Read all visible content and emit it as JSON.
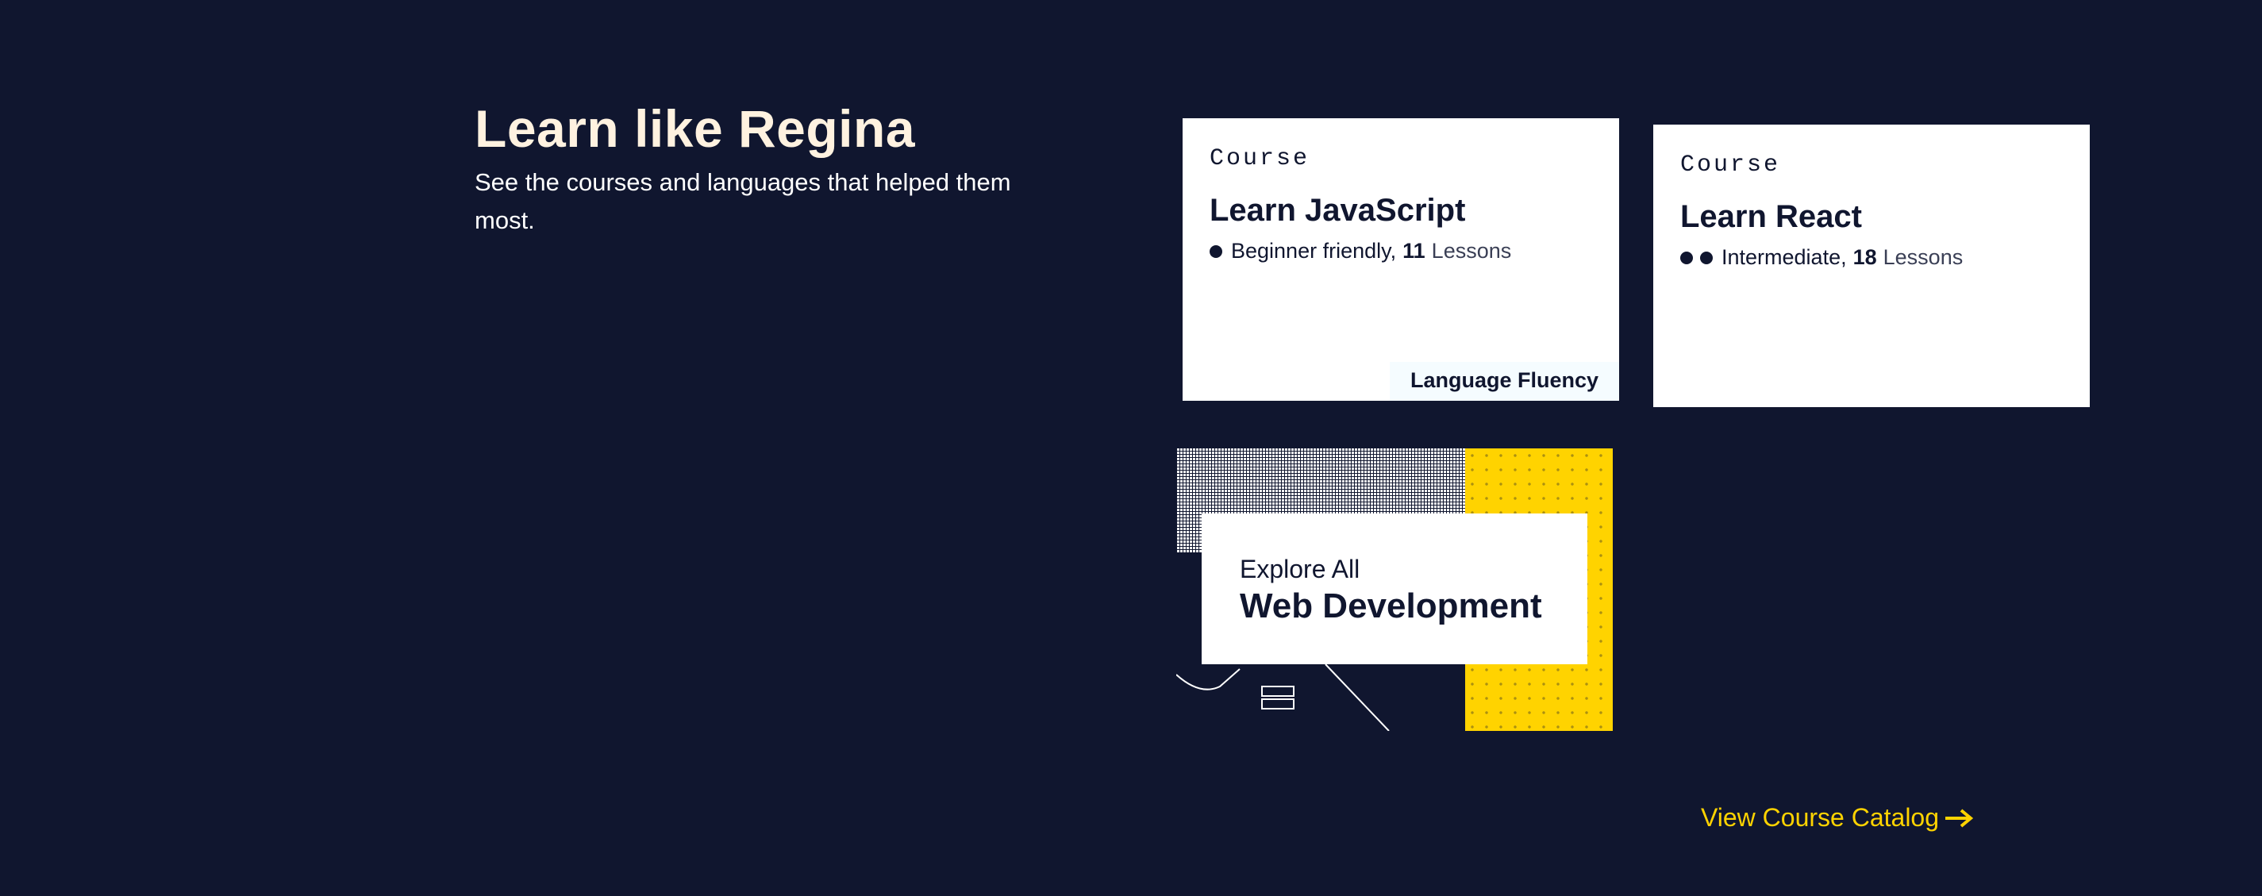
{
  "intro": {
    "title": "Learn like Regina",
    "subtitle": "See the courses and languages that helped them most."
  },
  "courses": [
    {
      "kind": "Course",
      "title": "Learn JavaScript",
      "level": "Beginner friendly,",
      "difficulty_dots": 1,
      "lesson_count": "11",
      "lesson_unit": "Lessons",
      "tag": "Language Fluency"
    },
    {
      "kind": "Course",
      "title": "Learn React",
      "level": "Intermediate,",
      "difficulty_dots": 2,
      "lesson_count": "18",
      "lesson_unit": "Lessons"
    }
  ],
  "explore": {
    "label": "Explore All",
    "title": "Web Development"
  },
  "catalog_link": {
    "label": "View Course Catalog",
    "icon": "arrow-right-icon"
  },
  "colors": {
    "background": "#10162f",
    "heading": "#fff2e0",
    "accent": "#ffd300",
    "card": "#ffffff"
  }
}
